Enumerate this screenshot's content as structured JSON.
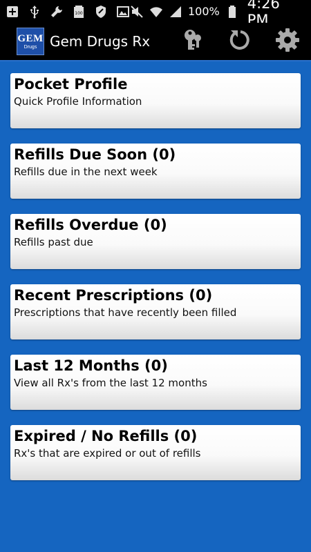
{
  "status_bar": {
    "icons_left": [
      "add-box-icon",
      "usb-icon",
      "wrench-icon",
      "battery-100-icon",
      "shield-icon",
      "image-icon"
    ],
    "icons_right": [
      "mute-icon",
      "wifi-icon",
      "signal-icon",
      "battery-icon"
    ],
    "battery_percent": "100%",
    "time": "4:26 PM"
  },
  "action_bar": {
    "logo": {
      "top": "GEM",
      "bottom": "Drugs"
    },
    "title": "Gem Drugs Rx",
    "actions": [
      "key-icon",
      "refresh-icon",
      "gear-icon"
    ]
  },
  "colors": {
    "background": "#1565c0",
    "bar": "#000000",
    "card_top": "#ffffff",
    "card_bottom": "#dcdcdc"
  },
  "menu": {
    "items": [
      {
        "title": "Pocket Profile",
        "subtitle": "Quick Profile Information"
      },
      {
        "title": "Refills Due Soon (0)",
        "subtitle": "Refills due in the next week"
      },
      {
        "title": "Refills Overdue (0)",
        "subtitle": "Refills past due"
      },
      {
        "title": "Recent Prescriptions (0)",
        "subtitle": "Prescriptions that have recently been filled"
      },
      {
        "title": "Last 12 Months (0)",
        "subtitle": "View all Rx's from the last 12 months"
      },
      {
        "title": "Expired / No Refills (0)",
        "subtitle": "Rx's that are expired or out of refills"
      }
    ]
  }
}
